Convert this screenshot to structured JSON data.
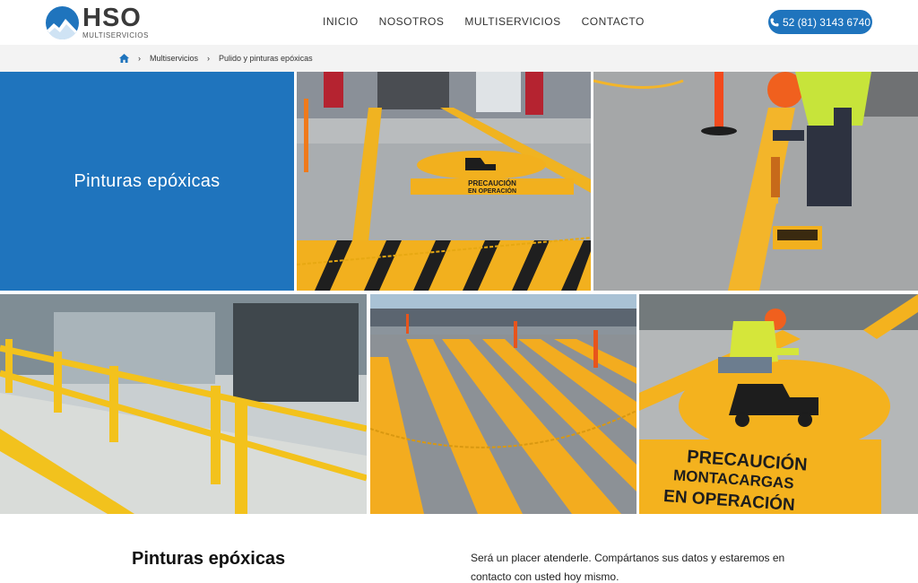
{
  "brand": {
    "name": "HSO",
    "tagline": "MULTISERVICIOS",
    "color": "#1f74bd"
  },
  "nav": {
    "items": [
      {
        "label": "INICIO"
      },
      {
        "label": "NOSOTROS"
      },
      {
        "label": "MULTISERVICIOS"
      },
      {
        "label": "CONTACTO"
      }
    ]
  },
  "phone": {
    "label": "52 (81) 3143 6740",
    "icon": "phone-icon"
  },
  "breadcrumb": {
    "home_icon": "home-icon",
    "items": [
      {
        "label": "Multiservicios"
      },
      {
        "label": "Pulido y pinturas epóxicas"
      }
    ]
  },
  "gallery": {
    "title": "Pinturas epóxicas",
    "signs": {
      "sign1_line1": "PRECAUCIÓN",
      "sign1_line2": "EN OPERACIÓN",
      "sign2_line1": "PRECAUCIÓN",
      "sign2_line2": "MONTACARGAS",
      "sign2_line3": "EN OPERACIÓN"
    }
  },
  "content": {
    "heading": "Pinturas epóxicas",
    "text": "Será un placer atenderle. Compártanos sus datos y estaremos en contacto con usted hoy mismo."
  }
}
